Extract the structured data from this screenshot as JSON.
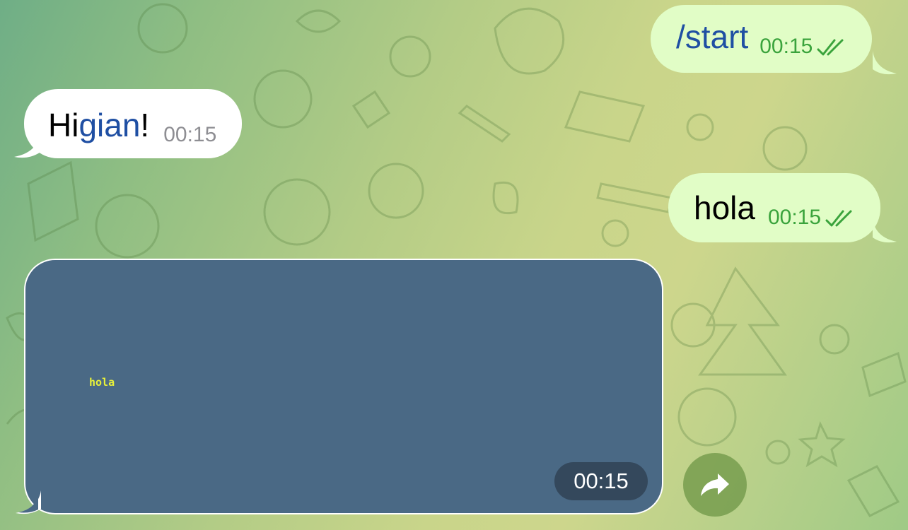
{
  "messages": [
    {
      "direction": "outgoing",
      "command": "/start",
      "time": "00:15",
      "status": "read"
    },
    {
      "direction": "incoming",
      "text_prefix": "Hi ",
      "mention": "gian",
      "text_suffix": "!",
      "time": "00:15"
    },
    {
      "direction": "outgoing",
      "text": "hola",
      "time": "00:15",
      "status": "read"
    },
    {
      "direction": "incoming",
      "type": "image",
      "image_caption": "hola",
      "time": "00:15"
    }
  ],
  "icons": {
    "read_status": "double-check-icon",
    "forward": "forward-arrow-icon"
  },
  "colors": {
    "outgoing_bubble": "#e1fdc6",
    "incoming_bubble": "#ffffff",
    "outgoing_time": "#3aa33c",
    "link": "#1f4fa3",
    "image_background": "#4a6985",
    "image_caption": "#e7f03a"
  }
}
